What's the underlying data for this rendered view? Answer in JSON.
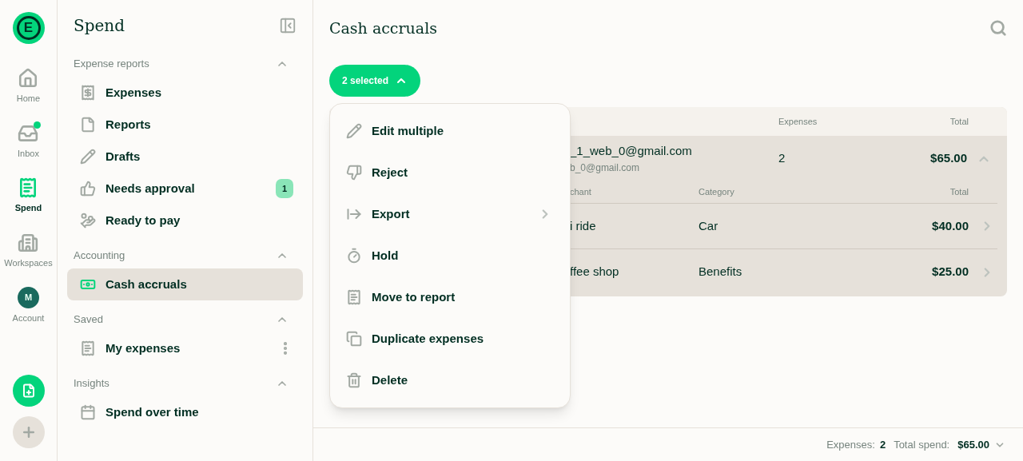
{
  "rail": {
    "logo": "E",
    "items": [
      {
        "label": "Home",
        "selected": false,
        "dot": false
      },
      {
        "label": "Inbox",
        "selected": false,
        "dot": true
      },
      {
        "label": "Spend",
        "selected": true,
        "dot": false
      },
      {
        "label": "Workspaces",
        "selected": false,
        "dot": false
      },
      {
        "label": "Account",
        "selected": false,
        "dot": false,
        "avatar": "M"
      }
    ]
  },
  "sidebar": {
    "title": "Spend",
    "sections": [
      {
        "title": "Expense reports",
        "expanded": true,
        "items": [
          {
            "label": "Expenses",
            "selected": false
          },
          {
            "label": "Reports",
            "selected": false
          },
          {
            "label": "Drafts",
            "selected": false
          },
          {
            "label": "Needs approval",
            "selected": false,
            "badge": "1"
          },
          {
            "label": "Ready to pay",
            "selected": false
          }
        ]
      },
      {
        "title": "Accounting",
        "expanded": true,
        "items": [
          {
            "label": "Cash accruals",
            "selected": true
          }
        ]
      },
      {
        "title": "Saved",
        "expanded": true,
        "items": [
          {
            "label": "My expenses",
            "selected": false,
            "more": true
          }
        ]
      },
      {
        "title": "Insights",
        "expanded": true,
        "items": [
          {
            "label": "Spend over time",
            "selected": false
          }
        ]
      }
    ]
  },
  "main": {
    "title": "Cash accruals",
    "selection_button": {
      "label": "2 selected",
      "expanded": true
    },
    "menu": [
      {
        "label": "Edit multiple",
        "submenu": false
      },
      {
        "label": "Reject",
        "submenu": false
      },
      {
        "label": "Export",
        "submenu": true
      },
      {
        "label": "Hold",
        "submenu": false
      },
      {
        "label": "Move to report",
        "submenu": false
      },
      {
        "label": "Duplicate expenses",
        "submenu": false
      },
      {
        "label": "Delete",
        "submenu": false
      }
    ],
    "table": {
      "columns": [
        "Expenses",
        "Total"
      ],
      "group": {
        "title": "_1_web_0@gmail.com",
        "subtitle": "b_0@gmail.com",
        "expenses": "2",
        "total": "$65.00",
        "expanded": true,
        "columns": [
          "chant",
          "Category",
          "Total"
        ],
        "rows": [
          {
            "merchant": "i ride",
            "category": "Car",
            "total": "$40.00"
          },
          {
            "merchant": "ffee shop",
            "category": "Benefits",
            "total": "$25.00"
          }
        ]
      }
    }
  },
  "footer": {
    "expenses_label": "Expenses:",
    "expenses": "2",
    "total_label": "Total spend:",
    "total": "$65.00"
  }
}
